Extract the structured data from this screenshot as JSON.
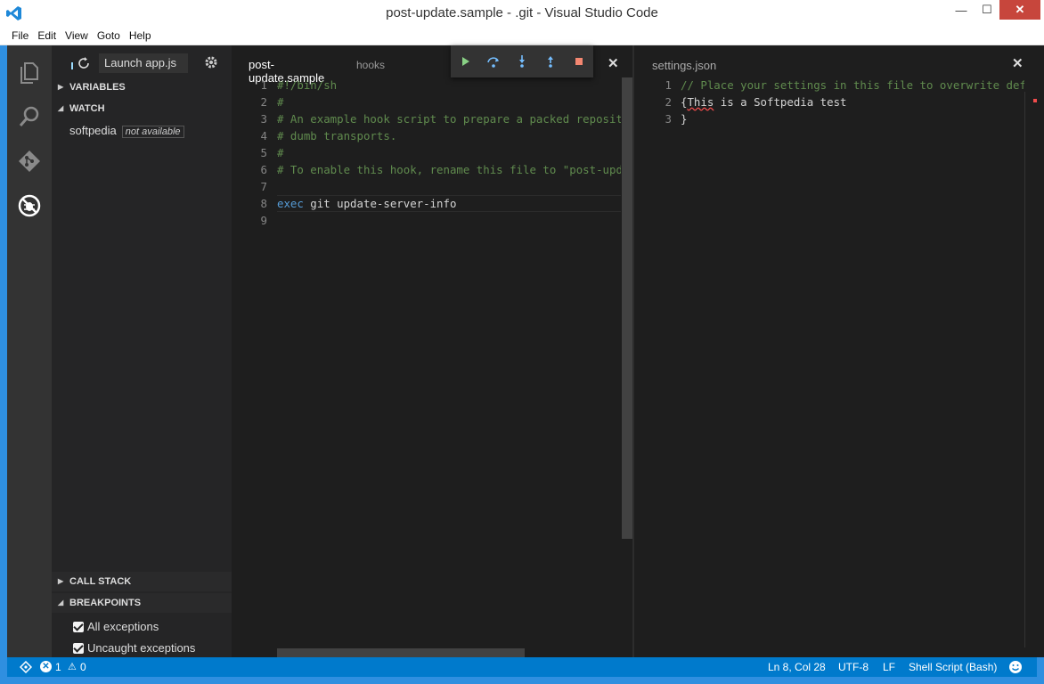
{
  "window": {
    "title": "post-update.sample - .git - Visual Studio Code",
    "min_glyph": "—",
    "max_glyph": "☐",
    "close_glyph": "✕"
  },
  "menu": [
    "File",
    "Edit",
    "View",
    "Goto",
    "Help"
  ],
  "activity_icons": [
    "files-icon",
    "search-icon",
    "git-icon",
    "debug-icon"
  ],
  "sidebar": {
    "launch_config": "Launch app.js",
    "sections": {
      "variables": "VARIABLES",
      "watch": "WATCH",
      "call_stack": "CALL STACK",
      "breakpoints": "BREAKPOINTS"
    },
    "watch": {
      "expression": "softpedia",
      "value": "not available"
    },
    "breakpoints": [
      {
        "label": "All exceptions",
        "checked": true
      },
      {
        "label": "Uncaught exceptions",
        "checked": true
      }
    ]
  },
  "editor_left": {
    "tab_title": "post-update.sample",
    "tab_desc": "hooks",
    "line_numbers": [
      "1",
      "2",
      "3",
      "4",
      "5",
      "6",
      "7",
      "8",
      "9"
    ],
    "lines": [
      [
        {
          "t": "#!/bin/sh",
          "c": "cmt"
        }
      ],
      [
        {
          "t": "#",
          "c": "cmt"
        }
      ],
      [
        {
          "t": "# An example hook script to prepare a packed repository for use over",
          "c": "cmt"
        }
      ],
      [
        {
          "t": "# dumb transports.",
          "c": "cmt"
        }
      ],
      [
        {
          "t": "#",
          "c": "cmt"
        }
      ],
      [
        {
          "t": "# To enable this hook, rename this file to \"post-update\".",
          "c": "cmt"
        }
      ],
      [
        {
          "t": "",
          "c": "plain"
        }
      ],
      [
        {
          "t": "exec",
          "c": "kw"
        },
        {
          "t": " git update-server-info",
          "c": "plain"
        }
      ],
      [
        {
          "t": "",
          "c": "plain"
        }
      ]
    ]
  },
  "editor_right": {
    "tab_title": "settings.json",
    "line_numbers": [
      "1",
      "2",
      "3"
    ],
    "line1": "// Place your settings in this file to overwrite default settings",
    "line2_brace": "{",
    "line2_word": "This",
    "line2_rest": " is a Softpedia test",
    "line3": "}"
  },
  "status": {
    "errors": "1",
    "warnings": "0",
    "position": "Ln 8, Col 28",
    "encoding": "UTF-8",
    "eol": "LF",
    "language": "Shell Script (Bash)"
  },
  "colors": {
    "accent": "#007acc",
    "comment": "#608b4e",
    "keyword": "#569cd6",
    "debug_continue": "#89d185",
    "debug_step": "#75beff",
    "debug_stop": "#f48771"
  }
}
